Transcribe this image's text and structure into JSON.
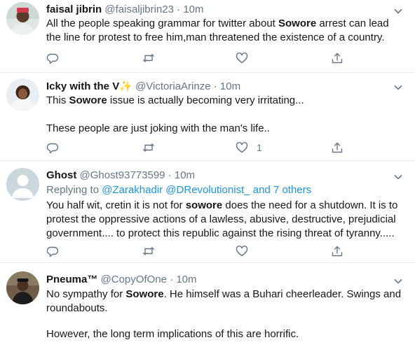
{
  "tweets": [
    {
      "name": "faisal jibrin",
      "handle": "@faisaljibrin23",
      "sep": "·",
      "time": "10m",
      "text_parts": [
        "All the people speaking grammar for twitter about ",
        "Sowore",
        " arrest can lead the line for protest to free him,man threatened the existence of a country."
      ],
      "like_count": ""
    },
    {
      "name": "Icky with the V",
      "name_emoji": "✨",
      "handle": "@VictoriaArinze",
      "sep": "·",
      "time": "10m",
      "text_parts": [
        "This ",
        "Sowore",
        " issue is actually becoming very irritating..."
      ],
      "text_line2": "These people are just joking with the man's life..",
      "like_count": "1"
    },
    {
      "name": "Ghost",
      "handle": "@Ghost93773599",
      "sep": "·",
      "time": "10m",
      "replying_prefix": "Replying to ",
      "replying_links": "@Zarakhadir @DRevolutionist_ and 7 others",
      "text_parts": [
        "You half wit, cretin it is not for ",
        "sowore",
        " does the need for a shutdown. It is to protest the oppressive actions of a lawless, abusive, destructive, prejudicial government.... to protect this republic against the rising threat of tyranny....."
      ],
      "like_count": ""
    },
    {
      "name": "Pneuma™",
      "handle": "@CopyOfOne",
      "sep": "·",
      "time": "10m",
      "text_parts": [
        "No sympathy for ",
        "Sowore",
        ". He himself was a Buhari cheerleader. Swings and roundabouts."
      ],
      "text_line2": "However, the long term implications of this are horrific."
    }
  ],
  "icons": {
    "reply": "reply-icon",
    "retweet": "retweet-icon",
    "like": "heart-icon",
    "share": "share-icon",
    "caret": "chevron-down-icon"
  },
  "colors": {
    "text": "#14171a",
    "muted": "#657786",
    "link": "#1b95e0",
    "divider": "#e6ecf0"
  }
}
